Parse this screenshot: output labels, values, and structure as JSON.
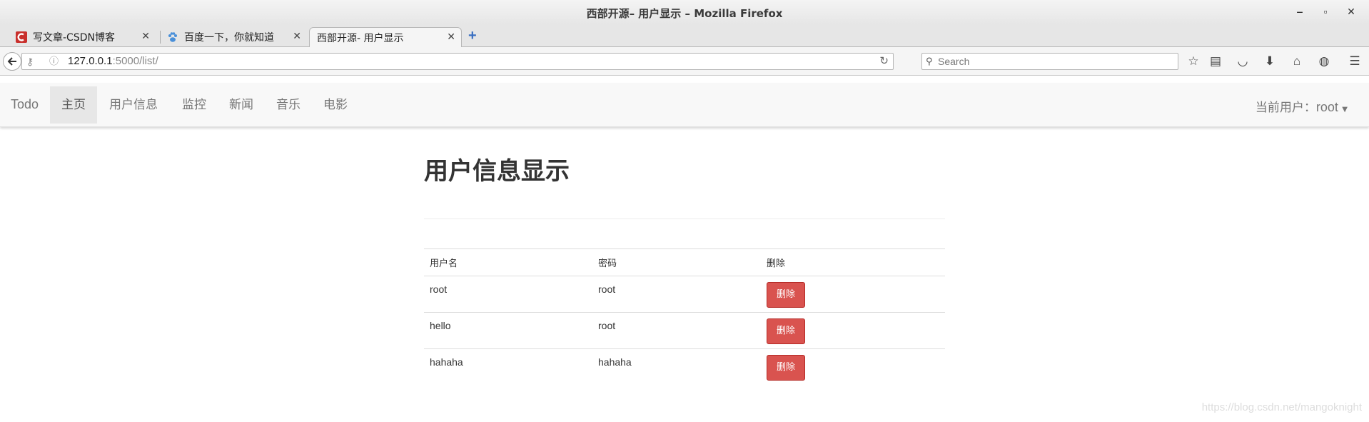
{
  "window": {
    "title": "西部开源– 用户显示 – Mozilla Firefox",
    "minimize": "‒",
    "maximize": "▫",
    "close": "✕"
  },
  "tabs": [
    {
      "label": "写文章-CSDN博客",
      "close": "✕"
    },
    {
      "label": "百度一下，你就知道",
      "close": "✕"
    },
    {
      "label": "西部开源- 用户显示",
      "close": "✕"
    }
  ],
  "new_tab": "+",
  "nav": {
    "url_host": "127.0.0.1",
    "url_path": ":5000/list/",
    "search_placeholder": "Search"
  },
  "app": {
    "brand": "Todo",
    "menu": [
      "主页",
      "用户信息",
      "监控",
      "新闻",
      "音乐",
      "电影"
    ],
    "active_index": 0,
    "user_label": "当前用户：",
    "user_name": "root"
  },
  "page": {
    "heading": "用户信息显示",
    "columns": [
      "用户名",
      "密码",
      "删除"
    ],
    "rows": [
      {
        "username": "root",
        "password": "root",
        "action": "删除"
      },
      {
        "username": "hello",
        "password": "root",
        "action": "删除"
      },
      {
        "username": "hahaha",
        "password": "hahaha",
        "action": "删除"
      }
    ]
  },
  "watermark": "https://blog.csdn.net/mangoknight",
  "colors": {
    "danger": "#d9534f",
    "firefox_blue": "#4a90d9",
    "csdn_red": "#c9302c"
  }
}
